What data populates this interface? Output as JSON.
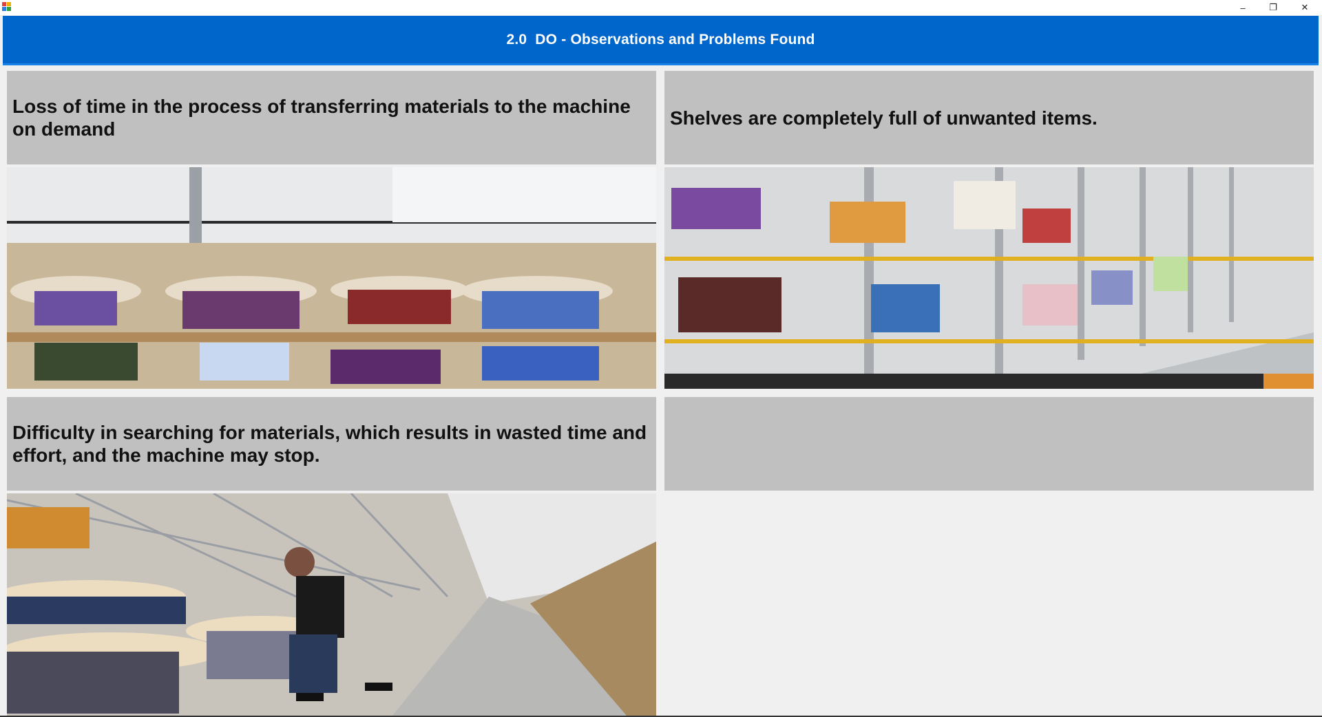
{
  "window": {
    "minimize_glyph": "–",
    "maximize_glyph": "❐",
    "close_glyph": "✕"
  },
  "header": {
    "title": "2.0  DO - Observations and Problems Found"
  },
  "cards": [
    {
      "caption": "Loss of time in the process of transferring materials to the machine on demand",
      "image_subject": "cable-reels-on-pallets"
    },
    {
      "caption": "Shelves are completely full of unwanted items.",
      "image_subject": "cable-reels-on-shelves"
    },
    {
      "caption": "Difficulty in searching for materials, which results in wasted time and effort, and the machine may stop.",
      "image_subject": "worker-searching-reels"
    },
    {
      "caption": "",
      "image_subject": ""
    }
  ],
  "colors": {
    "header_bg": "#0066cc",
    "caption_bg": "#c0c0c0",
    "page_bg": "#f0f0f0"
  }
}
